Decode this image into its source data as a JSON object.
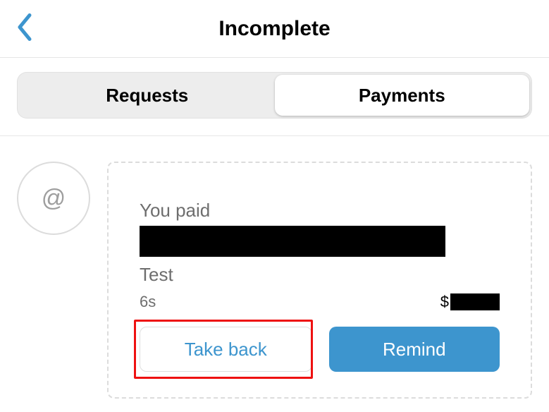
{
  "header": {
    "title": "Incomplete"
  },
  "tabs": {
    "requests": "Requests",
    "payments": "Payments"
  },
  "avatar_symbol": "@",
  "card": {
    "paid_prefix": "You paid",
    "note": "Test",
    "time": "6s",
    "currency": "$",
    "take_back_label": "Take back",
    "remind_label": "Remind"
  }
}
